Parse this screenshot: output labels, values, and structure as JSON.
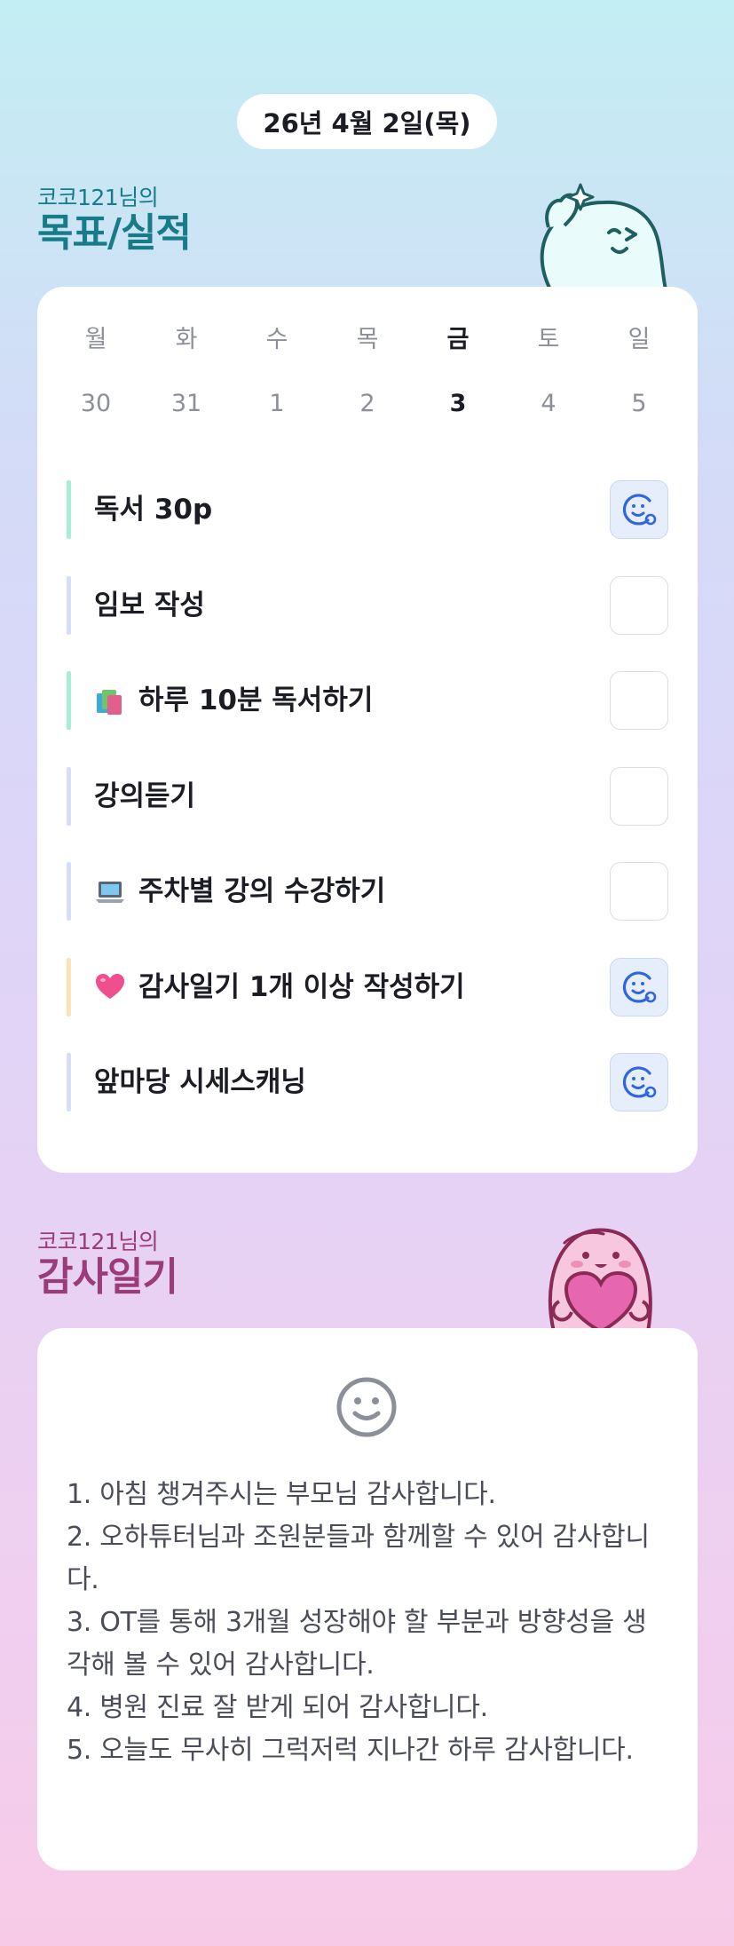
{
  "date": "26년 4월 2일(목)",
  "goals_section": {
    "subtitle": "코코121님의",
    "title": "목표/실적"
  },
  "week": {
    "days": [
      {
        "name": "월",
        "num": "30",
        "today": false
      },
      {
        "name": "화",
        "num": "31",
        "today": false
      },
      {
        "name": "수",
        "num": "1",
        "today": false
      },
      {
        "name": "목",
        "num": "2",
        "today": false
      },
      {
        "name": "금",
        "num": "3",
        "today": true
      },
      {
        "name": "토",
        "num": "4",
        "today": false
      },
      {
        "name": "일",
        "num": "5",
        "today": false
      }
    ]
  },
  "goals": [
    {
      "label": "독서 30p",
      "bar_color": "#a7eed9",
      "emoji": null,
      "done": true
    },
    {
      "label": "임보 작성",
      "bar_color": "#d6def8",
      "emoji": null,
      "done": false
    },
    {
      "label": "하루 10분 독서하기",
      "bar_color": "#a7eed9",
      "emoji": "books-emoji",
      "done": false
    },
    {
      "label": "강의듣기",
      "bar_color": "#d6def8",
      "emoji": null,
      "done": false
    },
    {
      "label": "주차별 강의 수강하기",
      "bar_color": "#d6def8",
      "emoji": "laptop-emoji",
      "done": false
    },
    {
      "label": "감사일기 1개 이상 작성하기",
      "bar_color": "#fde2b6",
      "emoji": "heart-emoji",
      "done": true
    },
    {
      "label": "앞마당 시세스캐닝",
      "bar_color": "#d6def8",
      "emoji": null,
      "done": true
    }
  ],
  "thanks_section": {
    "subtitle": "코코121님의",
    "title": "감사일기"
  },
  "thanks_lines": [
    "1. 아침 챙겨주시는 부모님 감사합니다.",
    "2. 오하튜터님과 조원분들과 함께할 수 있어 감사합니다.",
    "3. OT를 통해 3개월 성장해야 할 부분과 방향성을 생각해 볼 수 있어 감사합니다.",
    "4. 병원 진료 잘 받게 되어 감사합니다.",
    "5. 오늘도 무사히 그럭저럭 지나간 하루 감사합니다."
  ],
  "colors": {
    "goal_heading": "#157c88",
    "thanks_heading": "#9b3b7a",
    "done_check_bg": "#e6eefc",
    "done_check_icon": "#2f66e0"
  }
}
